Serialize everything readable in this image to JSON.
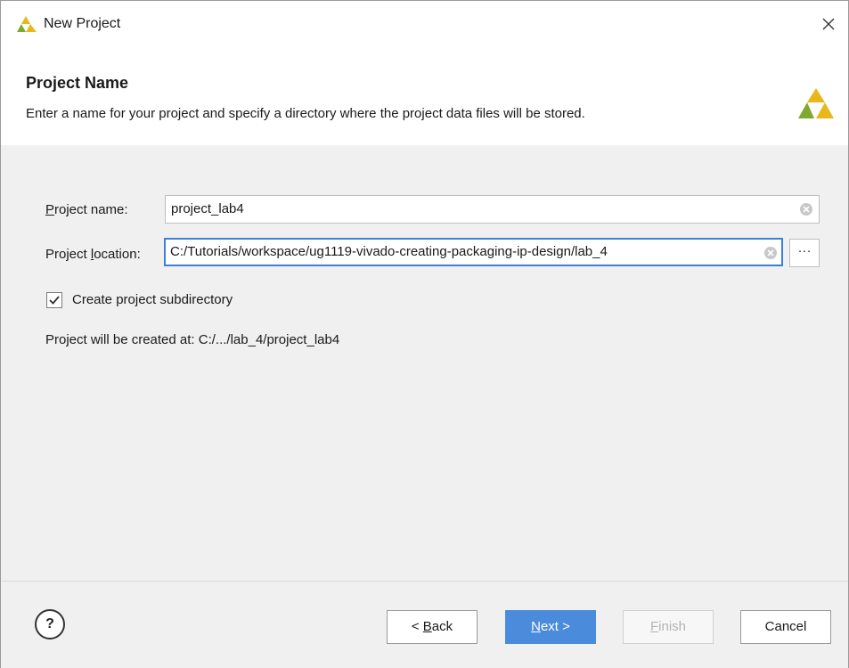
{
  "window": {
    "title": "New Project"
  },
  "header": {
    "title": "Project Name",
    "description": "Enter a name for your project and specify a directory where the project data files will be stored."
  },
  "form": {
    "project_name_label": "Project name:",
    "project_name_value": "project_lab4",
    "project_location_label": "Project location:",
    "project_location_value": "C:/Tutorials/workspace/ug1119-vivado-creating-packaging-ip-design/lab_4",
    "browse_label": "···",
    "create_subdir_label": "Create project subdirectory",
    "create_subdir_checked": true,
    "created_at_text": "Project will be created at: C:/.../lab_4/project_lab4"
  },
  "footer": {
    "help_label": "?",
    "back_label": "< Back",
    "next_label": "Next >",
    "finish_label": "Finish",
    "cancel_label": "Cancel"
  },
  "colors": {
    "accent": "#4a8bdc",
    "focus_border": "#3c7fd6",
    "content_bg": "#f0f0f0",
    "logo_yellow": "#e8b81a",
    "logo_green": "#7ea82f"
  }
}
